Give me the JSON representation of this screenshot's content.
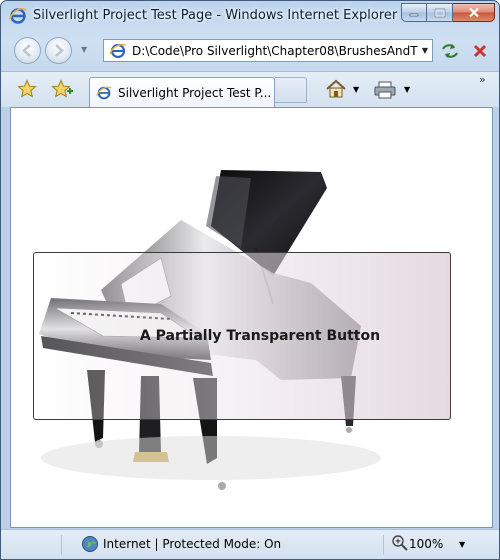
{
  "window": {
    "title": "Silverlight Project Test Page - Windows Internet Explorer"
  },
  "address": {
    "url": "D:\\Code\\Pro Silverlight\\Chapter08\\BrushesAndT",
    "dropdown_glyph": "▼"
  },
  "tabs": [
    {
      "label": "Silverlight Project Test P..."
    }
  ],
  "toolbar": {
    "more_glyph": "»",
    "dropdown_glyph": "▼"
  },
  "content": {
    "button_label": "A Partially Transparent Button"
  },
  "status": {
    "zone_text": "Internet | Protected Mode: On",
    "zoom_text": "100%",
    "dropdown_glyph": "▼"
  },
  "colors": {
    "frame": "#bcd3ec",
    "close_button": "#c8563a",
    "content_background": "#ffffff"
  },
  "icons": [
    "ie-icon",
    "minimize-icon",
    "maximize-icon",
    "close-icon",
    "back-arrow-icon",
    "forward-arrow-icon",
    "refresh-icon",
    "stop-icon",
    "favorites-star-icon",
    "add-favorites-icon",
    "home-icon",
    "print-icon",
    "globe-icon",
    "zoom-icon"
  ]
}
